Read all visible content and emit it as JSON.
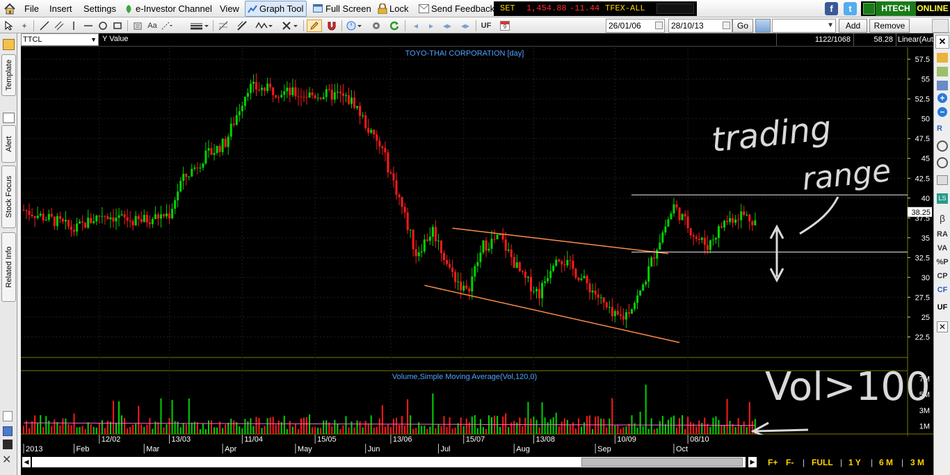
{
  "menu": {
    "file": "File",
    "insert": "Insert",
    "settings": "Settings",
    "einvestor": "e-Investor Channel",
    "view": "View",
    "graph_tool": "Graph Tool",
    "full_screen": "Full Screen",
    "lock": "Lock",
    "send_feedback": "Send Feedback"
  },
  "ticker": {
    "set_label": "SET",
    "set_value": "1,454.88",
    "set_change": "-11.44",
    "tfex_label": "TFEX-ALL",
    "set_value_color": "#ff2b2b",
    "label_color": "#ffd400"
  },
  "status": {
    "broker": "HTECH",
    "online": "ONLINE",
    "online_color": "#ffff33",
    "broker_bg": "#1a7a1a"
  },
  "toolbar": {
    "uf_label": "UF",
    "calendar_day": "9",
    "date_from": "26/01/06",
    "date_to": "28/10/13",
    "go": "Go",
    "add": "Add",
    "remove": "Remove",
    "icons": [
      "home-icon",
      "cursor-icon",
      "crosshair-icon",
      "line-icon",
      "parallel-icon",
      "vertical-line-icon",
      "horizontal-line-icon",
      "circle-icon",
      "rectangle-icon",
      "eraser-icon",
      "text-icon",
      "line-style-icon",
      "line-width-icon",
      "fibonacci-icon",
      "trend-icon",
      "pattern-icon",
      "delete-icon",
      "pencil-icon",
      "magnet-icon",
      "refresh-icon",
      "settings-icon",
      "nav-first-icon",
      "nav-prev-icon",
      "nav-next-icon",
      "nav-last-icon"
    ]
  },
  "chart": {
    "symbol": "TTCL",
    "y_caption": "Y Value",
    "bars_info": "1122/1068",
    "cursor_value": "58.28",
    "scale_mode": "Linear(Auto",
    "title": "TOYO-THAI CORPORATION [day]",
    "last_price": "38.25",
    "price_ticks": [
      "57.5",
      "55",
      "52.5",
      "50",
      "47.5",
      "45",
      "42.5",
      "40",
      "37.5",
      "35",
      "32.5",
      "30",
      "27.5",
      "25",
      "22.5"
    ],
    "volume_title": "Volume,Simple Moving Average(Vol,120,0)",
    "volume_ticks": [
      "7M",
      "5M",
      "3M",
      "1M"
    ],
    "date_labels": [
      "12/02",
      "13/03",
      "11/04",
      "15/05",
      "13/06",
      "15/07",
      "13/08",
      "10/09",
      "08/10"
    ],
    "month_labels": [
      "2013",
      "Feb",
      "Mar",
      "Apr",
      "May",
      "Jun",
      "Jul",
      "Aug",
      "Sep",
      "Oct"
    ],
    "annotation_trading": "trading",
    "annotation_range": "range",
    "annotation_vol": "Vol>100",
    "up_color": "#00d400",
    "down_color": "#ff1a1a",
    "axis_color": "#7a7a00",
    "title_color": "#4fa3ff"
  },
  "chart_data": {
    "type": "candlestick",
    "title": "TOYO-THAI CORPORATION [day]",
    "symbol": "TTCL",
    "ylim": [
      20,
      59
    ],
    "monthly_close_approx": [
      {
        "x": "2013-01",
        "y": 38.5
      },
      {
        "x": "2013-02",
        "y": 37.5
      },
      {
        "x": "2013-03",
        "y": 38.5
      },
      {
        "x": "2013-04",
        "y": 54
      },
      {
        "x": "2013-05",
        "y": 53.5
      },
      {
        "x": "2013-06",
        "y": 33
      },
      {
        "x": "2013-07",
        "y": 31
      },
      {
        "x": "2013-08",
        "y": 27
      },
      {
        "x": "2013-09",
        "y": 36
      },
      {
        "x": "2013-10",
        "y": 38.25
      }
    ],
    "last_price": 38.25,
    "drawn_lines": [
      {
        "name": "trading-range-top",
        "y": 40.4
      },
      {
        "name": "trading-range-bottom",
        "y": 33.2
      }
    ],
    "volume_ticks_M": [
      1,
      3,
      5,
      7
    ],
    "volume_indicator": "Simple Moving Average(Vol,120,0)",
    "bottom_nav": [
      "FULL",
      "1 Y",
      "6 M",
      "3 M"
    ]
  },
  "bottom": {
    "full": "FULL",
    "y1": "1 Y",
    "m6": "6 M",
    "m3": "3 M"
  },
  "sidetabs": {
    "template": "Template",
    "alert": "Alert",
    "stock_focus": "Stock Focus",
    "related_info": "Related Info"
  },
  "rightbar": [
    "β",
    "RA",
    "VA",
    "%P",
    "CP",
    "CF",
    "UF"
  ]
}
